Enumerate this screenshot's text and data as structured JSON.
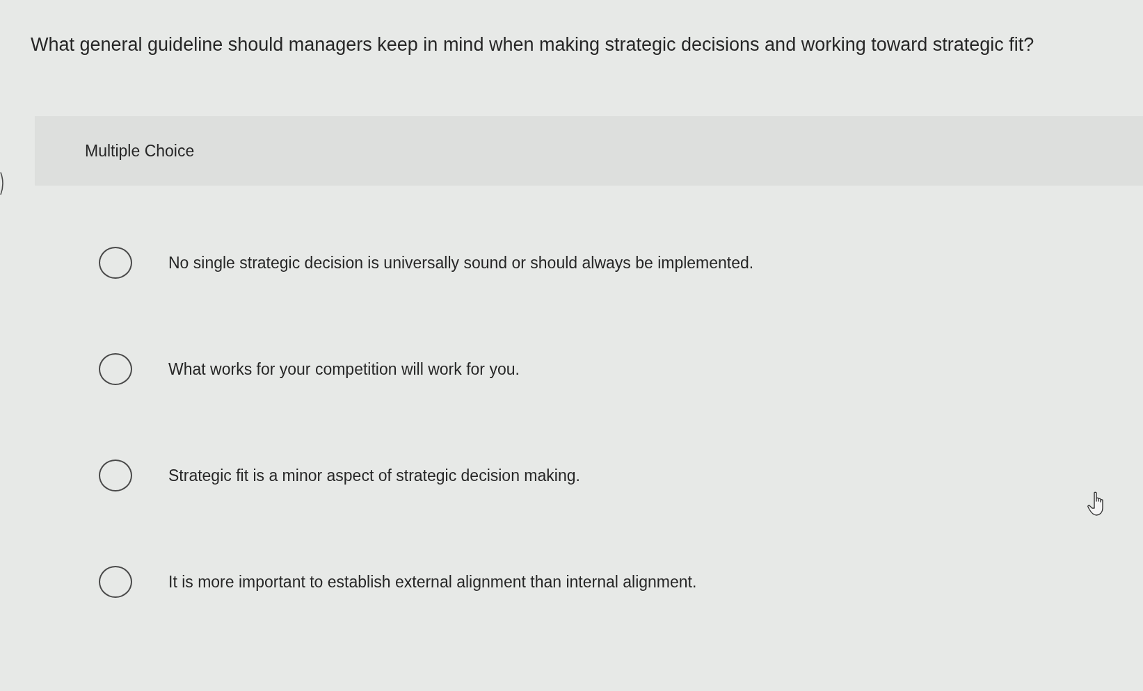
{
  "question": {
    "text": "What general guideline should managers keep in mind when making strategic decisions and working toward strategic fit?"
  },
  "answer_panel": {
    "heading": "Multiple Choice",
    "options": [
      {
        "label": "No single strategic decision is universally sound or should always be implemented.",
        "selected": false
      },
      {
        "label": "What works for your competition will work for you.",
        "selected": false
      },
      {
        "label": "Strategic fit is a minor aspect of strategic decision making.",
        "selected": false
      },
      {
        "label": "It is more important to establish external alignment than internal alignment.",
        "selected": false
      }
    ]
  }
}
